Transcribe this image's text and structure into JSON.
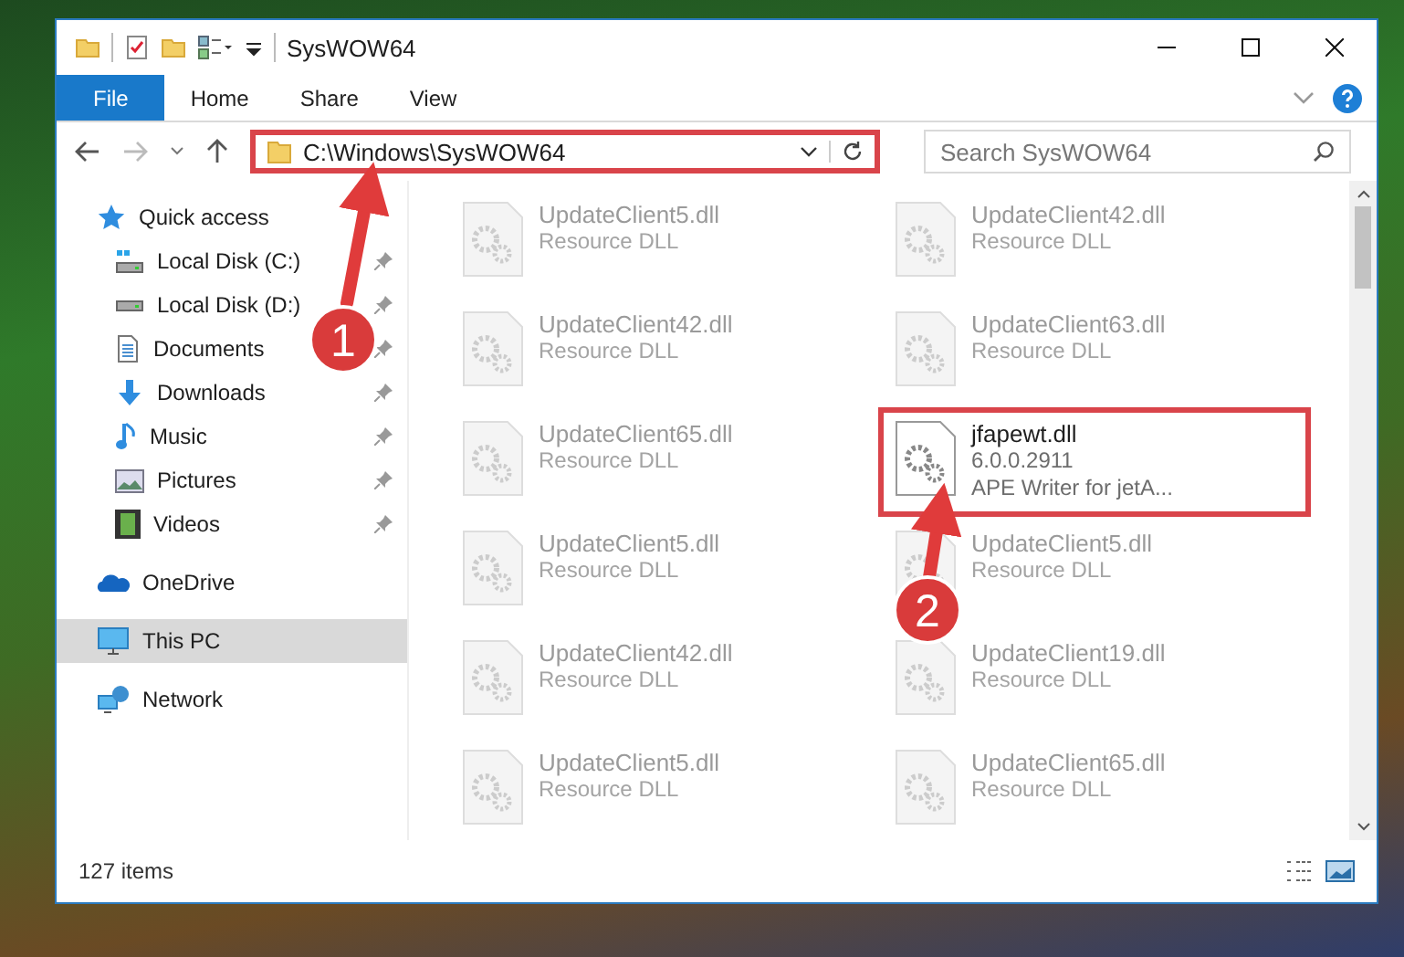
{
  "window": {
    "title": "SysWOW64"
  },
  "ribbon_tabs": [
    {
      "label": "File",
      "selected": true
    },
    {
      "label": "Home",
      "selected": false
    },
    {
      "label": "Share",
      "selected": false
    },
    {
      "label": "View",
      "selected": false
    }
  ],
  "address_bar": {
    "path": "C:\\Windows\\SysWOW64",
    "highlighted": true
  },
  "search": {
    "placeholder": "Search SysWOW64"
  },
  "sidebar": {
    "items": [
      {
        "label": "Quick access",
        "selected": false,
        "children": [
          {
            "label": "Local Disk (C:)",
            "pinned": true
          },
          {
            "label": "Local Disk (D:)",
            "pinned": true
          },
          {
            "label": "Documents",
            "pinned": true
          },
          {
            "label": "Downloads",
            "pinned": true
          },
          {
            "label": "Music",
            "pinned": true
          },
          {
            "label": "Pictures",
            "pinned": true
          },
          {
            "label": "Videos",
            "pinned": true
          }
        ]
      },
      {
        "label": "OneDrive",
        "selected": false
      },
      {
        "label": "This PC",
        "selected": true
      },
      {
        "label": "Network",
        "selected": false
      }
    ]
  },
  "files": [
    {
      "name": "UpdateClient5.dll",
      "details": [
        "Resource DLL"
      ],
      "blurred": true,
      "highlighted": false
    },
    {
      "name": "UpdateClient42.dll",
      "details": [
        "Resource DLL"
      ],
      "blurred": true,
      "highlighted": false
    },
    {
      "name": "UpdateClient42.dll",
      "details": [
        "Resource DLL"
      ],
      "blurred": true,
      "highlighted": false
    },
    {
      "name": "UpdateClient63.dll",
      "details": [
        "Resource DLL"
      ],
      "blurred": true,
      "highlighted": false
    },
    {
      "name": "UpdateClient65.dll",
      "details": [
        "Resource DLL"
      ],
      "blurred": true,
      "highlighted": false
    },
    {
      "name": "jfapewt.dll",
      "details": [
        "6.0.0.2911",
        "APE Writer for jetA..."
      ],
      "blurred": false,
      "highlighted": true
    },
    {
      "name": "UpdateClient5.dll",
      "details": [
        "Resource DLL"
      ],
      "blurred": true,
      "highlighted": false
    },
    {
      "name": "UpdateClient5.dll",
      "details": [
        "Resource DLL"
      ],
      "blurred": true,
      "highlighted": false
    },
    {
      "name": "UpdateClient42.dll",
      "details": [
        "Resource DLL"
      ],
      "blurred": true,
      "highlighted": false
    },
    {
      "name": "UpdateClient19.dll",
      "details": [
        "Resource DLL"
      ],
      "blurred": true,
      "highlighted": false
    },
    {
      "name": "UpdateClient5.dll",
      "details": [
        "Resource DLL"
      ],
      "blurred": true,
      "highlighted": false
    },
    {
      "name": "UpdateClient65.dll",
      "details": [
        "Resource DLL"
      ],
      "blurred": true,
      "highlighted": false
    }
  ],
  "status_bar": {
    "item_count": "127 items"
  },
  "callouts": [
    {
      "number": "1"
    },
    {
      "number": "2"
    }
  ]
}
